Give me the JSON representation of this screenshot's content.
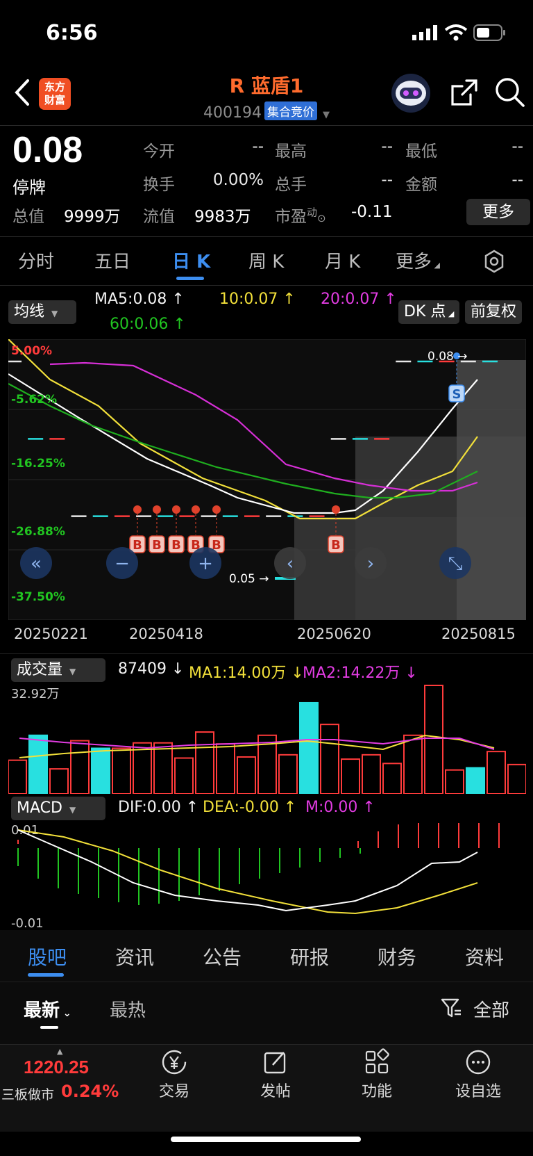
{
  "status": {
    "time": "6:56"
  },
  "header": {
    "logo_line1": "东方",
    "logo_line2": "财富",
    "stock_name": "R 蓝盾1",
    "stock_code": "400194",
    "auction_tag": "集合竞价"
  },
  "quote": {
    "price": "0.08",
    "status": "停牌",
    "fields": [
      {
        "label": "今开",
        "value": "--"
      },
      {
        "label": "最高",
        "value": "--"
      },
      {
        "label": "最低",
        "value": "--"
      },
      {
        "label": "换手",
        "value": "0.00%"
      },
      {
        "label": "总手",
        "value": "--"
      },
      {
        "label": "金额",
        "value": "--"
      }
    ],
    "total_value_label": "总值",
    "total_value": "9999万",
    "float_value_label": "流值",
    "float_value": "9983万",
    "pe_label": "市盈",
    "pe_sup": "动",
    "pe_value": "-0.11",
    "more_button": "更多"
  },
  "kline_tabs": [
    "分时",
    "五日",
    "日 K",
    "周 K",
    "月 K",
    "更多"
  ],
  "kline_active": "日 K",
  "ma_bar": {
    "selector": "均线",
    "ma5": "MA5:0.08 ↑",
    "ma10": "10:0.07 ↑",
    "ma20": "20:0.07 ↑",
    "ma60": "60:0.06 ↑",
    "dk_button": "DK 点",
    "adjust_button": "前复权"
  },
  "chart_data": {
    "type": "candlestick",
    "y_axis_labels": [
      "5.00%",
      "-5.62%",
      "-16.25%",
      "-26.88%",
      "-37.50%"
    ],
    "x_axis_labels": [
      "20250221",
      "20250418",
      "20250620",
      "20250815"
    ],
    "max_price_label": "0.08",
    "min_price_label": "0.05",
    "buy_marker": "B",
    "sell_marker": "S",
    "candles": [
      {
        "date": "c1",
        "close": 0.08
      },
      {
        "date": "c2",
        "close": 0.07
      },
      {
        "date": "c3",
        "close": 0.07
      },
      {
        "date": "c4",
        "close": 0.06
      },
      {
        "date": "c5",
        "close": 0.06
      },
      {
        "date": "c6",
        "close": 0.06
      },
      {
        "date": "c7",
        "close": 0.06
      },
      {
        "date": "c8",
        "close": 0.06
      },
      {
        "date": "c9",
        "close": 0.06
      },
      {
        "date": "c10",
        "close": 0.06
      },
      {
        "date": "c11",
        "close": 0.06
      },
      {
        "date": "c12",
        "close": 0.06
      },
      {
        "date": "c13",
        "close": 0.06
      },
      {
        "date": "c14",
        "close": 0.06
      },
      {
        "date": "c15",
        "close": 0.06
      },
      {
        "date": "c16",
        "close": 0.07
      },
      {
        "date": "c17",
        "close": 0.07
      },
      {
        "date": "c18",
        "close": 0.07
      },
      {
        "date": "c19",
        "close": 0.08
      },
      {
        "date": "c20",
        "close": 0.08
      },
      {
        "date": "c21",
        "close": 0.08
      },
      {
        "date": "c22",
        "close": 0.08
      },
      {
        "date": "c23",
        "close": 0.08
      }
    ],
    "series": [
      {
        "name": "MA5",
        "color": "#ffffff"
      },
      {
        "name": "MA10",
        "color": "#f2e03a"
      },
      {
        "name": "MA20",
        "color": "#d62fd6"
      },
      {
        "name": "MA60",
        "color": "#1fae1f"
      }
    ]
  },
  "volume": {
    "selector": "成交量",
    "current": "87409 ↓",
    "ma1": "MA1:14.00万 ↓",
    "ma2": "MA2:14.22万 ↓",
    "max_label": "32.92万",
    "bars": [
      0.31,
      0.54,
      0.23,
      0.49,
      0.42,
      0.42,
      0.47,
      0.47,
      0.33,
      0.57,
      0.46,
      0.34,
      0.54,
      0.36,
      0.84,
      0.64,
      0.32,
      0.36,
      0.28,
      0.54,
      1.0,
      0.22,
      0.24,
      0.39,
      0.27
    ],
    "bar_kinds": [
      "r",
      "c",
      "r",
      "r",
      "c",
      "r",
      "r",
      "r",
      "r",
      "r",
      "r",
      "r",
      "r",
      "r",
      "c",
      "r",
      "r",
      "r",
      "r",
      "r",
      "r",
      "r",
      "c",
      "r",
      "r"
    ]
  },
  "macd": {
    "selector": "MACD",
    "dif": "DIF:0.00 ↑",
    "dea": "DEA:-0.00 ↑",
    "m": "M:0.00 ↑",
    "top_label": "0.01",
    "bottom_label": "-0.01"
  },
  "bottom_tabs": [
    "股吧",
    "资讯",
    "公告",
    "研报",
    "财务",
    "资料"
  ],
  "bottom_tab_active": "股吧",
  "sort_tabs": {
    "latest": "最新",
    "hottest": "最热",
    "filter": "全部"
  },
  "index": {
    "value": "1220.25",
    "name": "三板做市",
    "change": "0.24%"
  },
  "nav": [
    {
      "label": "交易",
      "icon": "yen-icon"
    },
    {
      "label": "发帖",
      "icon": "edit-icon"
    },
    {
      "label": "功能",
      "icon": "grid-icon"
    },
    {
      "label": "设自选",
      "icon": "more-icon"
    }
  ]
}
